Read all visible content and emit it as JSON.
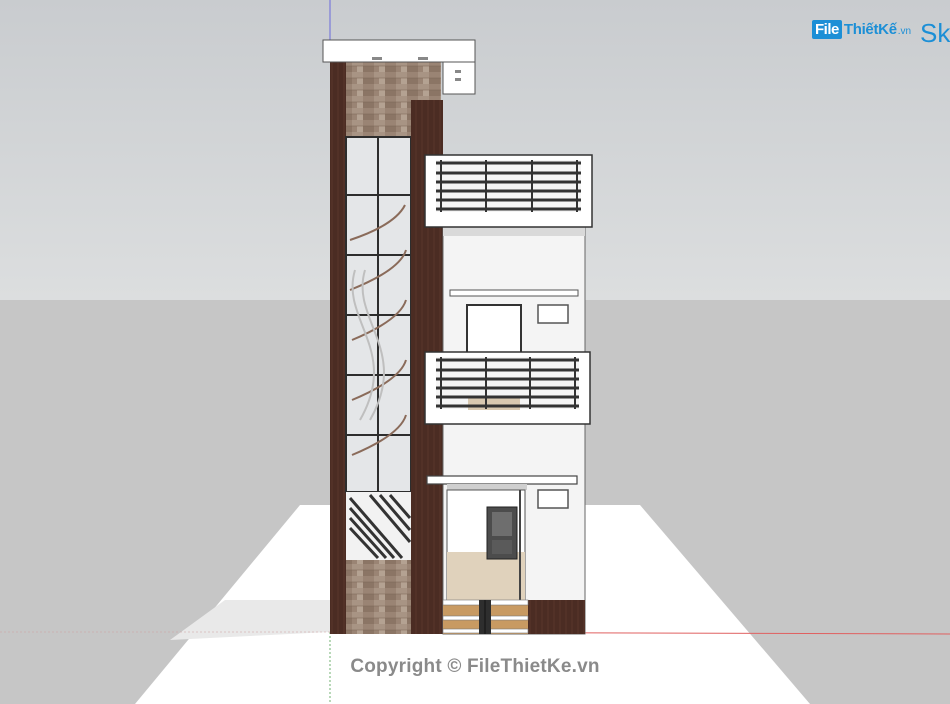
{
  "watermark": {
    "logo_badge": "File",
    "logo_rest": "ThiếtKế",
    "logo_tld": ".vn",
    "sketchup_partial": "Sk"
  },
  "copyright": "Copyright © FileThietKe.vn",
  "colors": {
    "sky": "#d4d6d8",
    "ground": "#c9c9c9",
    "slab": "#ffffff",
    "wood": "#4a2b22",
    "stone": "#9a8070",
    "wall": "#f7f7f7",
    "rail": "#3a3a3a",
    "brand": "#1c8fd6"
  }
}
